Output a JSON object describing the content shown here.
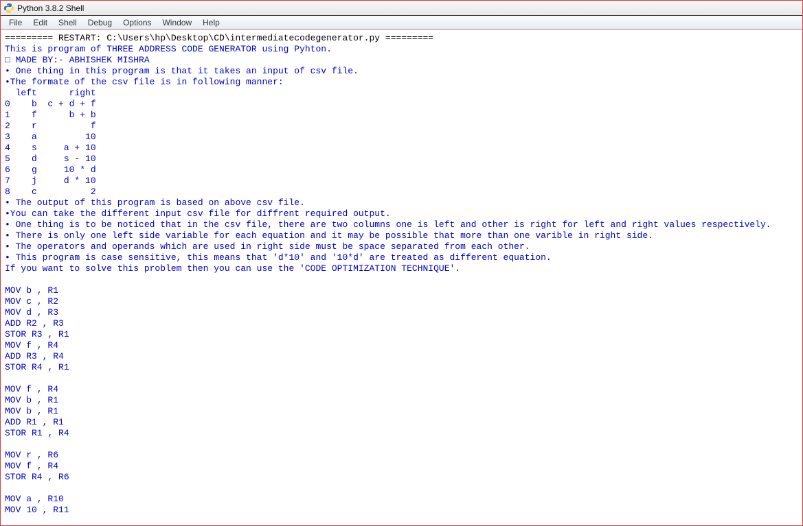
{
  "title": "Python 3.8.2 Shell",
  "menu": [
    "File",
    "Edit",
    "Shell",
    "Debug",
    "Options",
    "Window",
    "Help"
  ],
  "lines": [
    {
      "cls": "black",
      "t": "========= RESTART: C:\\Users\\hp\\Desktop\\CD\\intermediatecodegenerator.py ========="
    },
    {
      "cls": "blue",
      "t": "This is program of THREE ADDRESS CODE GENERATOR using Pyhton."
    },
    {
      "cls": "blue",
      "t": "□ MADE BY:- ABHISHEK MISHRA"
    },
    {
      "cls": "blue",
      "t": "• One thing in this program is that it takes an input of csv file."
    },
    {
      "cls": "blue",
      "t": "•The formate of the csv file is in following manner:"
    },
    {
      "cls": "blue",
      "t": "  left      right"
    },
    {
      "cls": "blue",
      "t": "0    b  c + d + f"
    },
    {
      "cls": "blue",
      "t": "1    f      b + b"
    },
    {
      "cls": "blue",
      "t": "2    r          f"
    },
    {
      "cls": "blue",
      "t": "3    a         10"
    },
    {
      "cls": "blue",
      "t": "4    s     a + 10"
    },
    {
      "cls": "blue",
      "t": "5    d     s - 10"
    },
    {
      "cls": "blue",
      "t": "6    g     10 * d"
    },
    {
      "cls": "blue",
      "t": "7    j     d * 10"
    },
    {
      "cls": "blue",
      "t": "8    c          2"
    },
    {
      "cls": "blue",
      "t": "• The output of this program is based on above csv file."
    },
    {
      "cls": "blue",
      "t": "•You can take the different input csv file for diffrent required output."
    },
    {
      "cls": "blue",
      "t": "• One thing is to be noticed that in the csv file, there are two columns one is left and other is right for left and right values respectively."
    },
    {
      "cls": "blue",
      "t": "• There is only one left side variable for each equation and it may be possible that more than one varible in right side."
    },
    {
      "cls": "blue",
      "t": "• The operators and operands which are used in right side must be space separated from each other."
    },
    {
      "cls": "blue",
      "t": "• This program is case sensitive, this means that 'd*10' and '10*d' are treated as different equation."
    },
    {
      "cls": "blue",
      "t": "If you want to solve this problem then you can use the 'CODE OPTIMIZATION TECHNIQUE'."
    },
    {
      "cls": "blue",
      "t": ""
    },
    {
      "cls": "blue",
      "t": "MOV b , R1"
    },
    {
      "cls": "blue",
      "t": "MOV c , R2"
    },
    {
      "cls": "blue",
      "t": "MOV d , R3"
    },
    {
      "cls": "blue",
      "t": "ADD R2 , R3"
    },
    {
      "cls": "blue",
      "t": "STOR R3 , R1"
    },
    {
      "cls": "blue",
      "t": "MOV f , R4"
    },
    {
      "cls": "blue",
      "t": "ADD R3 , R4"
    },
    {
      "cls": "blue",
      "t": "STOR R4 , R1"
    },
    {
      "cls": "blue",
      "t": ""
    },
    {
      "cls": "blue",
      "t": "MOV f , R4"
    },
    {
      "cls": "blue",
      "t": "MOV b , R1"
    },
    {
      "cls": "blue",
      "t": "MOV b , R1"
    },
    {
      "cls": "blue",
      "t": "ADD R1 , R1"
    },
    {
      "cls": "blue",
      "t": "STOR R1 , R4"
    },
    {
      "cls": "blue",
      "t": ""
    },
    {
      "cls": "blue",
      "t": "MOV r , R6"
    },
    {
      "cls": "blue",
      "t": "MOV f , R4"
    },
    {
      "cls": "blue",
      "t": "STOR R4 , R6"
    },
    {
      "cls": "blue",
      "t": ""
    },
    {
      "cls": "blue",
      "t": "MOV a , R10"
    },
    {
      "cls": "blue",
      "t": "MOV 10 , R11"
    }
  ]
}
